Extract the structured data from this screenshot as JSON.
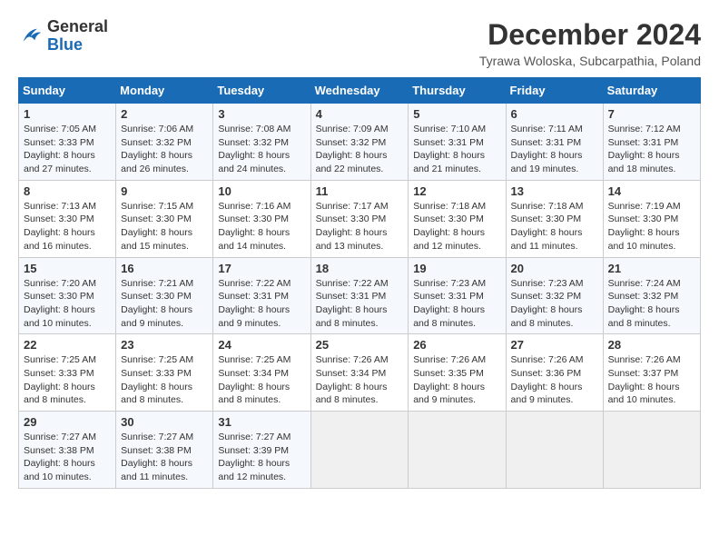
{
  "logo": {
    "text_general": "General",
    "text_blue": "Blue"
  },
  "header": {
    "month": "December 2024",
    "location": "Tyrawa Woloska, Subcarpathia, Poland"
  },
  "weekdays": [
    "Sunday",
    "Monday",
    "Tuesday",
    "Wednesday",
    "Thursday",
    "Friday",
    "Saturday"
  ],
  "weeks": [
    [
      {
        "day": "1",
        "sunrise": "7:05 AM",
        "sunset": "3:33 PM",
        "daylight": "8 hours and 27 minutes."
      },
      {
        "day": "2",
        "sunrise": "7:06 AM",
        "sunset": "3:32 PM",
        "daylight": "8 hours and 26 minutes."
      },
      {
        "day": "3",
        "sunrise": "7:08 AM",
        "sunset": "3:32 PM",
        "daylight": "8 hours and 24 minutes."
      },
      {
        "day": "4",
        "sunrise": "7:09 AM",
        "sunset": "3:32 PM",
        "daylight": "8 hours and 22 minutes."
      },
      {
        "day": "5",
        "sunrise": "7:10 AM",
        "sunset": "3:31 PM",
        "daylight": "8 hours and 21 minutes."
      },
      {
        "day": "6",
        "sunrise": "7:11 AM",
        "sunset": "3:31 PM",
        "daylight": "8 hours and 19 minutes."
      },
      {
        "day": "7",
        "sunrise": "7:12 AM",
        "sunset": "3:31 PM",
        "daylight": "8 hours and 18 minutes."
      }
    ],
    [
      {
        "day": "8",
        "sunrise": "7:13 AM",
        "sunset": "3:30 PM",
        "daylight": "8 hours and 16 minutes."
      },
      {
        "day": "9",
        "sunrise": "7:15 AM",
        "sunset": "3:30 PM",
        "daylight": "8 hours and 15 minutes."
      },
      {
        "day": "10",
        "sunrise": "7:16 AM",
        "sunset": "3:30 PM",
        "daylight": "8 hours and 14 minutes."
      },
      {
        "day": "11",
        "sunrise": "7:17 AM",
        "sunset": "3:30 PM",
        "daylight": "8 hours and 13 minutes."
      },
      {
        "day": "12",
        "sunrise": "7:18 AM",
        "sunset": "3:30 PM",
        "daylight": "8 hours and 12 minutes."
      },
      {
        "day": "13",
        "sunrise": "7:18 AM",
        "sunset": "3:30 PM",
        "daylight": "8 hours and 11 minutes."
      },
      {
        "day": "14",
        "sunrise": "7:19 AM",
        "sunset": "3:30 PM",
        "daylight": "8 hours and 10 minutes."
      }
    ],
    [
      {
        "day": "15",
        "sunrise": "7:20 AM",
        "sunset": "3:30 PM",
        "daylight": "8 hours and 10 minutes."
      },
      {
        "day": "16",
        "sunrise": "7:21 AM",
        "sunset": "3:30 PM",
        "daylight": "8 hours and 9 minutes."
      },
      {
        "day": "17",
        "sunrise": "7:22 AM",
        "sunset": "3:31 PM",
        "daylight": "8 hours and 9 minutes."
      },
      {
        "day": "18",
        "sunrise": "7:22 AM",
        "sunset": "3:31 PM",
        "daylight": "8 hours and 8 minutes."
      },
      {
        "day": "19",
        "sunrise": "7:23 AM",
        "sunset": "3:31 PM",
        "daylight": "8 hours and 8 minutes."
      },
      {
        "day": "20",
        "sunrise": "7:23 AM",
        "sunset": "3:32 PM",
        "daylight": "8 hours and 8 minutes."
      },
      {
        "day": "21",
        "sunrise": "7:24 AM",
        "sunset": "3:32 PM",
        "daylight": "8 hours and 8 minutes."
      }
    ],
    [
      {
        "day": "22",
        "sunrise": "7:25 AM",
        "sunset": "3:33 PM",
        "daylight": "8 hours and 8 minutes."
      },
      {
        "day": "23",
        "sunrise": "7:25 AM",
        "sunset": "3:33 PM",
        "daylight": "8 hours and 8 minutes."
      },
      {
        "day": "24",
        "sunrise": "7:25 AM",
        "sunset": "3:34 PM",
        "daylight": "8 hours and 8 minutes."
      },
      {
        "day": "25",
        "sunrise": "7:26 AM",
        "sunset": "3:34 PM",
        "daylight": "8 hours and 8 minutes."
      },
      {
        "day": "26",
        "sunrise": "7:26 AM",
        "sunset": "3:35 PM",
        "daylight": "8 hours and 9 minutes."
      },
      {
        "day": "27",
        "sunrise": "7:26 AM",
        "sunset": "3:36 PM",
        "daylight": "8 hours and 9 minutes."
      },
      {
        "day": "28",
        "sunrise": "7:26 AM",
        "sunset": "3:37 PM",
        "daylight": "8 hours and 10 minutes."
      }
    ],
    [
      {
        "day": "29",
        "sunrise": "7:27 AM",
        "sunset": "3:38 PM",
        "daylight": "8 hours and 10 minutes."
      },
      {
        "day": "30",
        "sunrise": "7:27 AM",
        "sunset": "3:38 PM",
        "daylight": "8 hours and 11 minutes."
      },
      {
        "day": "31",
        "sunrise": "7:27 AM",
        "sunset": "3:39 PM",
        "daylight": "8 hours and 12 minutes."
      },
      null,
      null,
      null,
      null
    ]
  ]
}
